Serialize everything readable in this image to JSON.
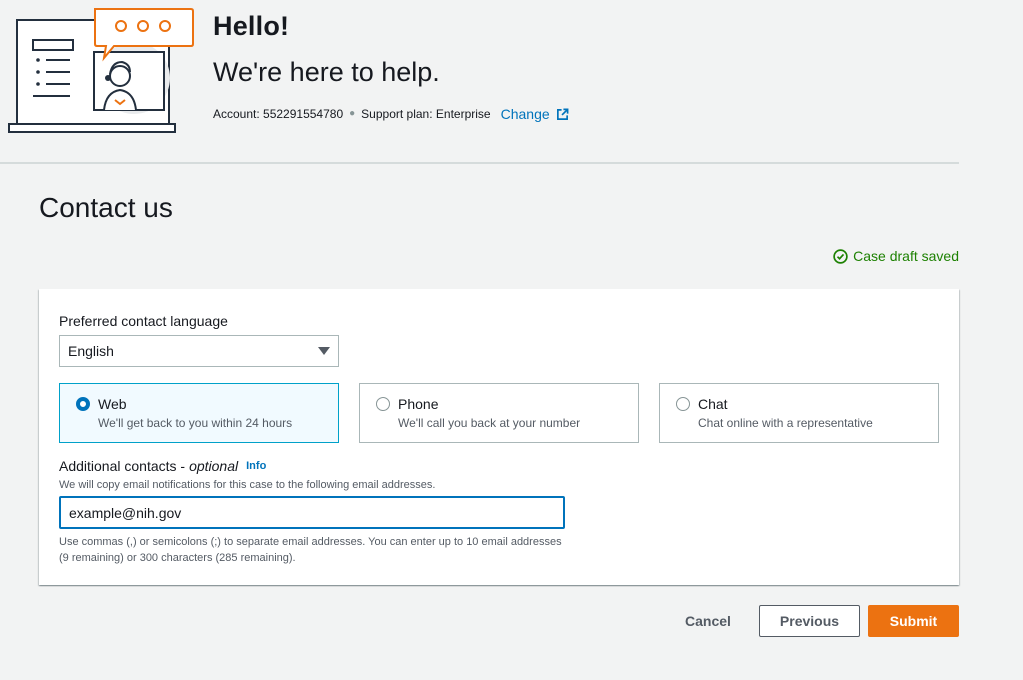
{
  "header": {
    "title": "Hello!",
    "subtitle": "We're here to help.",
    "account_label": "Account: 552291554780",
    "support_plan": "Support plan: Enterprise",
    "change_link": "Change",
    "illustration_icon": "support-agent-illustration",
    "external_icon": "external-link-icon"
  },
  "page": {
    "title": "Contact us",
    "draft_status": "Case draft saved",
    "draft_icon": "check-circle-icon",
    "success_color": "#1d8102"
  },
  "form": {
    "language": {
      "label": "Preferred contact language",
      "selected": "English"
    },
    "contact_methods": [
      {
        "title": "Web",
        "description": "We'll get back to you within 24 hours",
        "selected": true
      },
      {
        "title": "Phone",
        "description": "We'll call you back at your number",
        "selected": false
      },
      {
        "title": "Chat",
        "description": "Chat online with a representative",
        "selected": false
      }
    ],
    "additional_contacts": {
      "label": "Additional contacts -",
      "optional": "optional",
      "info": "Info",
      "description": "We will copy email notifications for this case to the following email addresses.",
      "value": "example@nih.gov",
      "constraint": "Use commas (,) or semicolons (;) to separate email addresses. You can enter up to 10 email addresses (9 remaining) or 300 characters (285 remaining)."
    }
  },
  "actions": {
    "cancel": "Cancel",
    "previous": "Previous",
    "submit": "Submit",
    "primary_color": "#ec7211",
    "link_color": "#0073bb"
  }
}
